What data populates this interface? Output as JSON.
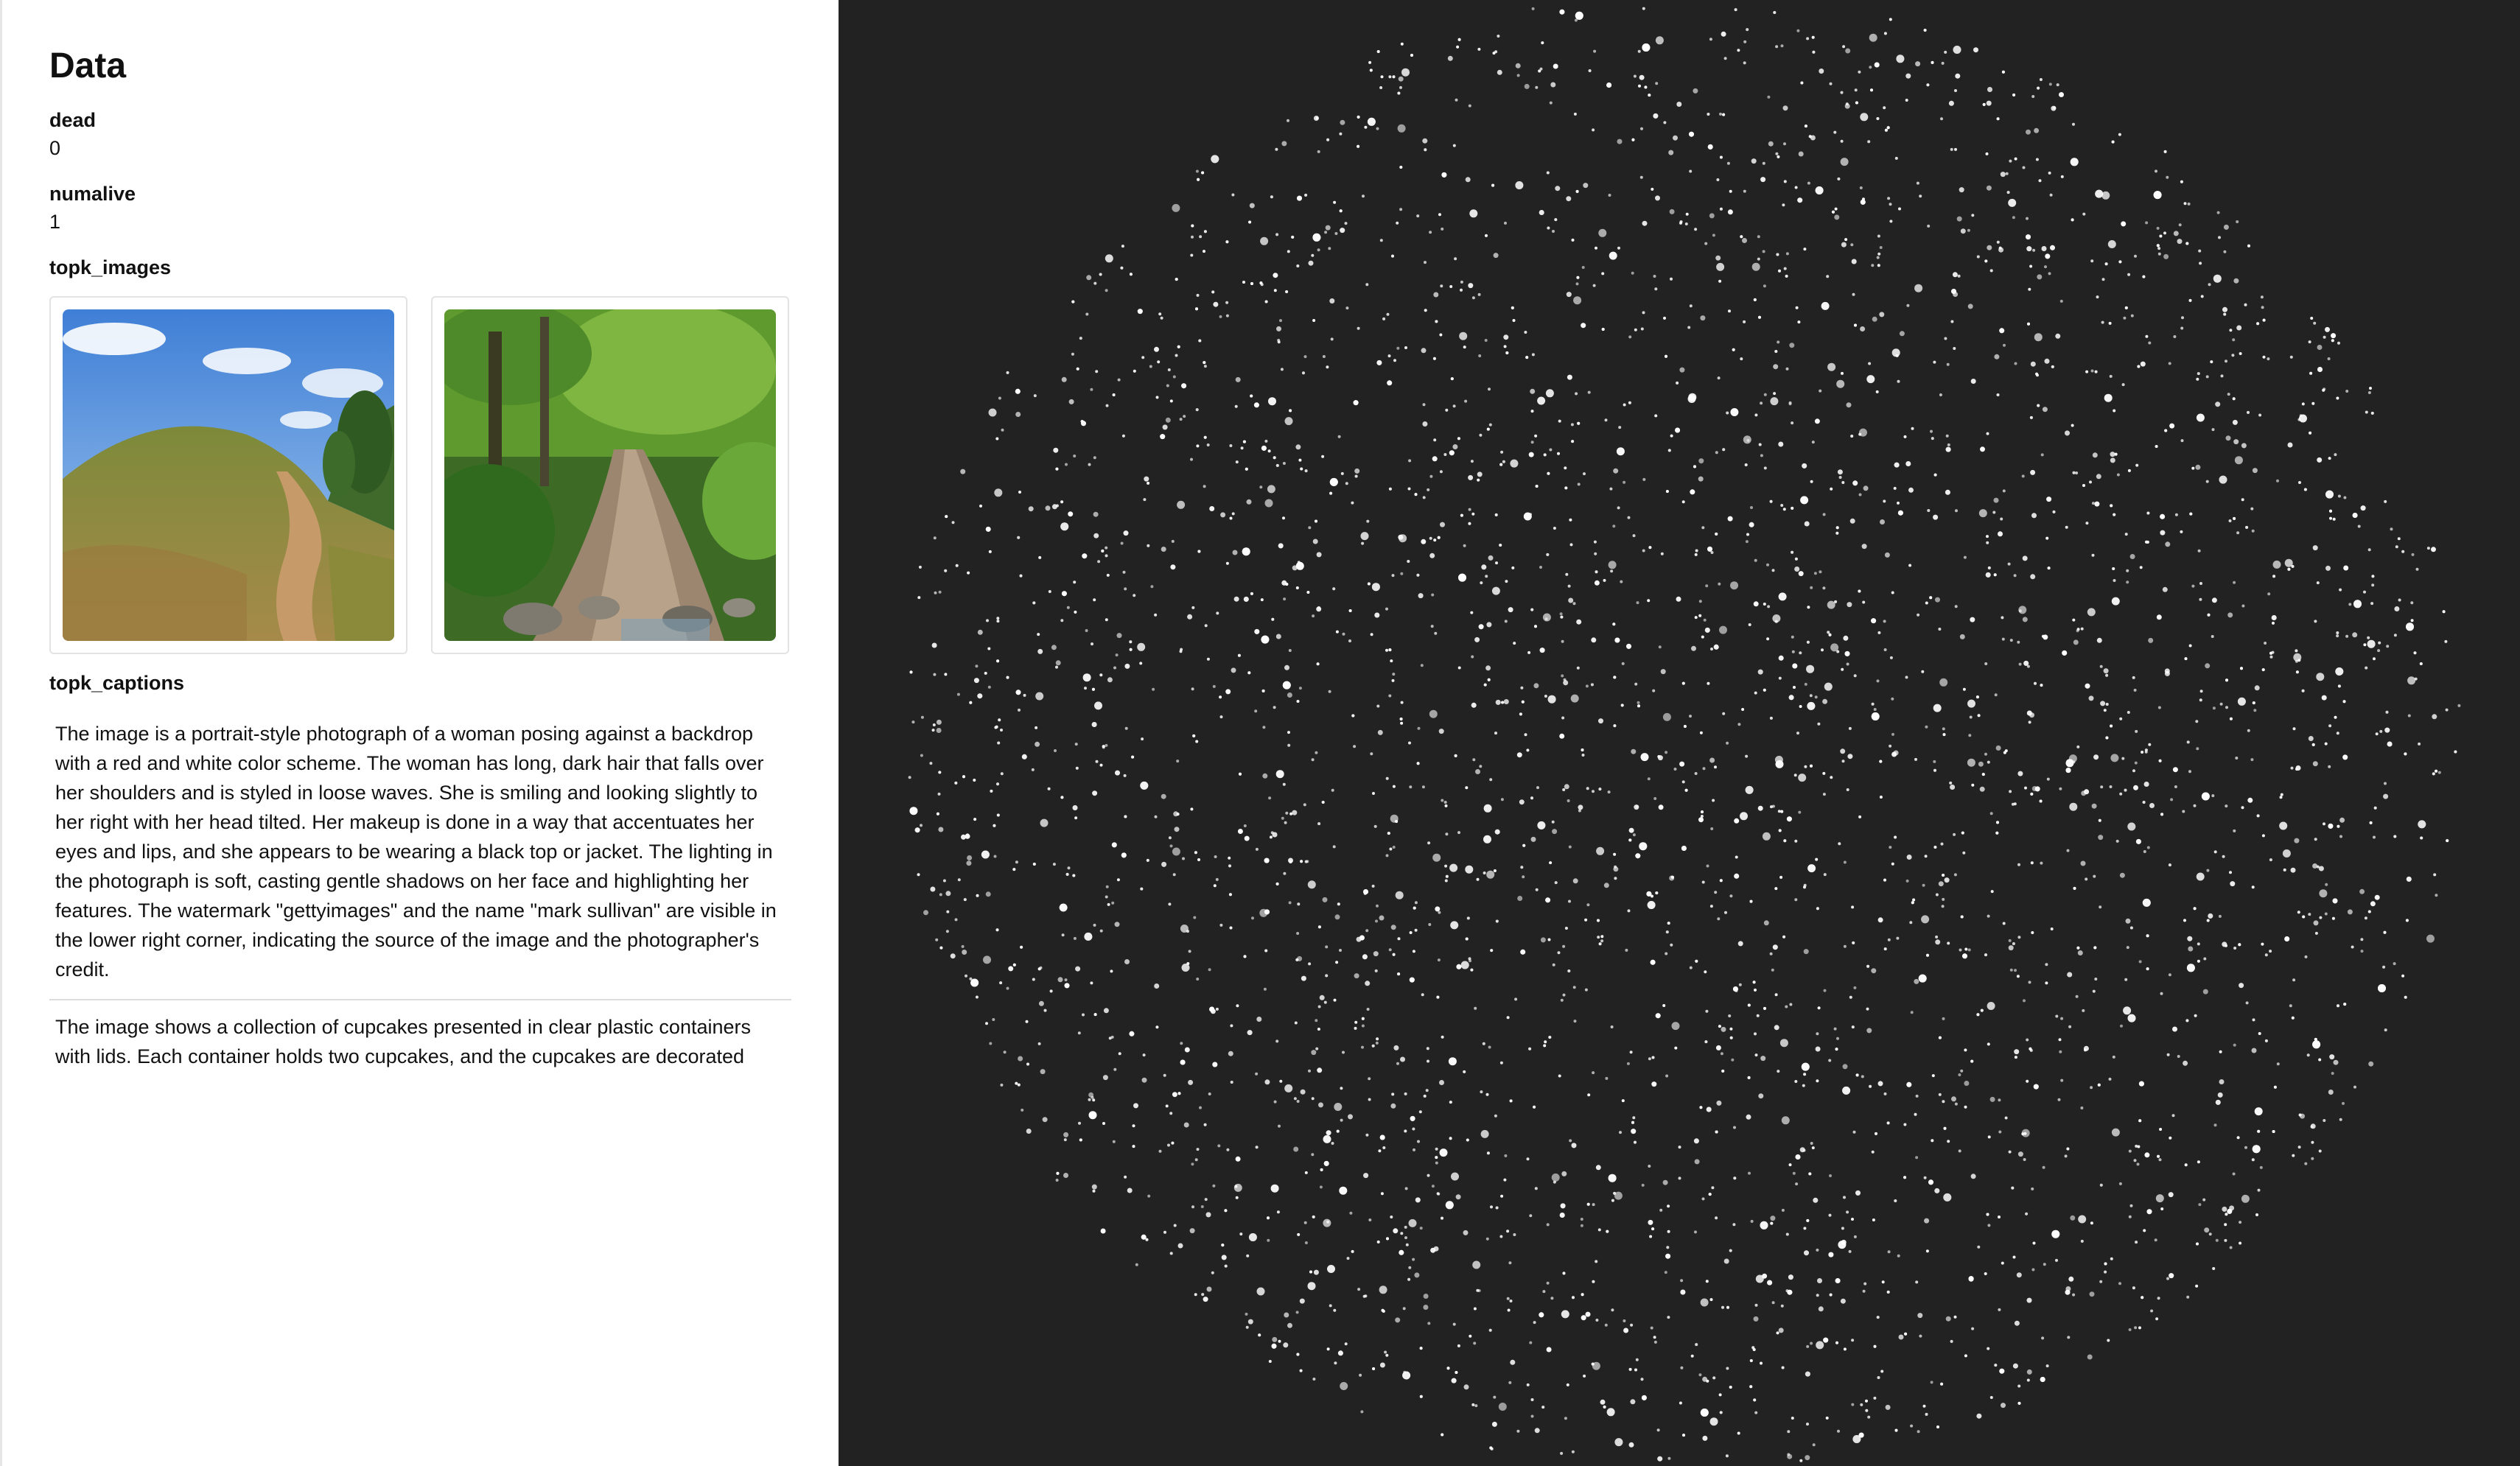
{
  "panel": {
    "title": "Data",
    "fields": {
      "dead_label": "dead",
      "dead_value": "0",
      "numalive_label": "numalive",
      "numalive_value": "1",
      "topk_images_label": "topk_images",
      "topk_captions_label": "topk_captions"
    },
    "images": [
      {
        "subject": "grassy-hill-with-dirt-path"
      },
      {
        "subject": "forest-trail-with-stream"
      }
    ],
    "captions": [
      "The image is a portrait-style photograph of a woman posing against a backdrop with a red and white color scheme. The woman has long, dark hair that falls over her shoulders and is styled in loose waves. She is smiling and looking slightly to her right with her head tilted. Her makeup is done in a way that accentuates her eyes and lips, and she appears to be wearing a black top or jacket. The lighting in the photograph is soft, casting gentle shadows on her face and highlighting her features. The watermark \"gettyimages\" and the name \"mark sullivan\" are visible in the lower right corner, indicating the source of the image and the photographer's credit.",
      "The image shows a collection of cupcakes presented in clear plastic containers with lids. Each container holds two cupcakes, and the cupcakes are decorated"
    ]
  },
  "colors": {
    "canvas_background": "#222222",
    "point_color": "#ffffff"
  }
}
